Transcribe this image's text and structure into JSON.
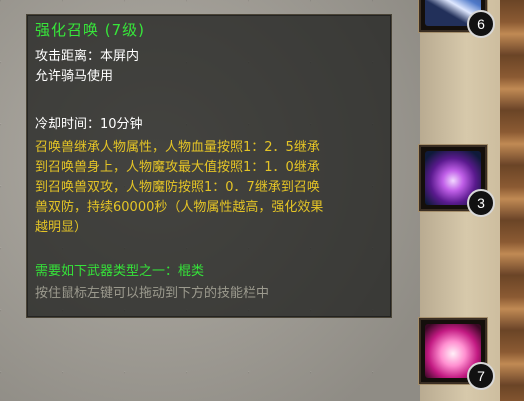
{
  "tooltip": {
    "title": "强化召唤 (7级)",
    "range": "攻击距离：本屏内",
    "mount": "允许骑马使用",
    "cooldown": "冷却时间：10分钟",
    "description_lines": [
      "召唤兽继承人物属性，人物血量按照1：2．5继承",
      "到召唤兽身上，人物魔攻最大值按照1：1．0继承",
      "到召唤兽双攻，人物魔防按照1：0．7继承到召唤",
      "兽双防，持续60000秒（人物属性越高，强化效果",
      "越明显）"
    ],
    "weapon_requirement": "需要如下武器类型之一：棍类",
    "hint": "按住鼠标左键可以拖动到下方的技能栏中"
  },
  "skill_slots": [
    {
      "count": "6",
      "icon": "sword-skill-icon"
    },
    {
      "count": "3",
      "icon": "purple-summon-skill-icon"
    },
    {
      "count": "7",
      "icon": "pink-burst-skill-icon"
    }
  ],
  "colors": {
    "title": "#37e63a",
    "description": "#e4c426",
    "requirement": "#35e339",
    "hint": "#9c9a8e"
  }
}
